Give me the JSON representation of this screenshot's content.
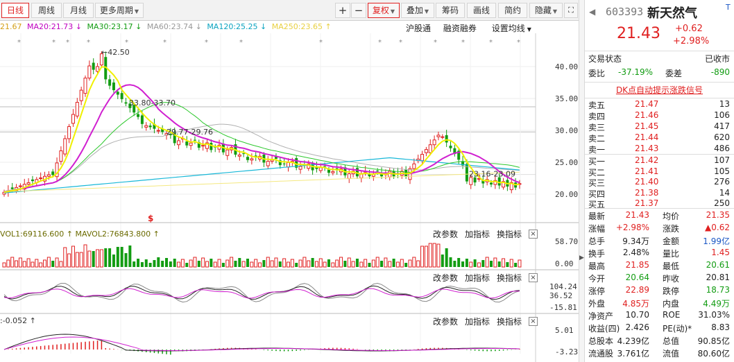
{
  "toolbar": {
    "tabs": [
      {
        "label": "日线",
        "active": true
      },
      {
        "label": "周线"
      },
      {
        "label": "月线"
      },
      {
        "label": "更多周期"
      }
    ],
    "zoom_in": "+",
    "zoom_out": "−",
    "buttons": [
      "复权",
      "叠加",
      "筹码",
      "画线",
      "简约",
      "隐藏"
    ]
  },
  "chart": {
    "ma_legend": [
      {
        "text": "21.67",
        "color": "#d4a017"
      },
      {
        "text": "MA20:21.73 ↓",
        "color": "#c000c0"
      },
      {
        "text": "MA30:23.17 ↓",
        "color": "#129c12"
      },
      {
        "text": "MA60:23.74 ↓",
        "color": "#999999"
      },
      {
        "text": "MA120:25.25 ↓",
        "color": "#0aa3c0"
      },
      {
        "text": "MA250:23.65 ↑",
        "color": "#f0e060"
      }
    ],
    "links": [
      "沪股通",
      "融资融券",
      "设置均线"
    ],
    "price_axis": [
      "40.00",
      "35.00",
      "30.00",
      "25.00",
      "20.00"
    ],
    "annotations": {
      "high": "42.50",
      "box1": "33.80-33.70",
      "box2": "29.77-29.76",
      "box3": "23.16-23.09"
    },
    "dollar": "$",
    "vol_label": "VOL1:69116.600 ↑ MAVOL2:76843.800 ↑",
    "vol_axis": [
      "58.70",
      "0.00"
    ],
    "kdj_axis": [
      "104.24",
      "36.52",
      "-15.81"
    ],
    "macd_label": ":-0.052 ↑",
    "macd_axis": [
      "5.01",
      "-3.23"
    ],
    "panel_links": [
      "改参数",
      "加指标",
      "换指标"
    ],
    "close": "×",
    "colors": {
      "up": "#e02020",
      "down": "#129c12",
      "ma5": "#f0f000",
      "ma10": "#d020d0",
      "ma30": "#2cc82c",
      "ma60": "#b0b0b0",
      "ma120": "#18b8d8"
    }
  },
  "quote": {
    "code": "603393",
    "name": "新天然气",
    "price": "21.43",
    "change": "+0.62",
    "change_pct": "+2.98%",
    "status_label": "交易状态",
    "status_value": "已收市",
    "weibi_label": "委比",
    "weibi_value": "-37.19%",
    "weicha_label": "委差",
    "weicha_value": "-890",
    "signal": "DK点自动提示涨跌信号",
    "asks": [
      {
        "label": "卖五",
        "price": "21.47",
        "vol": "13"
      },
      {
        "label": "卖四",
        "price": "21.46",
        "vol": "106"
      },
      {
        "label": "卖三",
        "price": "21.45",
        "vol": "417"
      },
      {
        "label": "卖二",
        "price": "21.44",
        "vol": "620"
      },
      {
        "label": "卖一",
        "price": "21.43",
        "vol": "486"
      }
    ],
    "bids": [
      {
        "label": "买一",
        "price": "21.42",
        "vol": "107"
      },
      {
        "label": "买二",
        "price": "21.41",
        "vol": "105"
      },
      {
        "label": "买三",
        "price": "21.40",
        "vol": "276"
      },
      {
        "label": "买四",
        "price": "21.38",
        "vol": "14"
      },
      {
        "label": "买五",
        "price": "21.37",
        "vol": "250"
      }
    ],
    "stats": [
      {
        "l1": "最新",
        "v1": "21.43",
        "c1": "red",
        "l2": "均价",
        "v2": "21.35",
        "c2": "red"
      },
      {
        "l1": "涨幅",
        "v1": "+2.98%",
        "c1": "red",
        "l2": "涨跌",
        "v2": "▲0.62",
        "c2": "red"
      },
      {
        "l1": "总手",
        "v1": "9.34万",
        "c1": "",
        "l2": "金额",
        "v2": "1.99亿",
        "c2": "blue"
      },
      {
        "l1": "换手",
        "v1": "2.48%",
        "c1": "",
        "l2": "量比",
        "v2": "1.45",
        "c2": "red"
      },
      {
        "l1": "最高",
        "v1": "21.85",
        "c1": "red",
        "l2": "最低",
        "v2": "20.61",
        "c2": "green"
      },
      {
        "l1": "今开",
        "v1": "20.64",
        "c1": "green",
        "l2": "昨收",
        "v2": "20.81",
        "c2": ""
      },
      {
        "l1": "涨停",
        "v1": "22.89",
        "c1": "red",
        "l2": "跌停",
        "v2": "18.73",
        "c2": "green"
      },
      {
        "l1": "外盘",
        "v1": "4.85万",
        "c1": "red",
        "l2": "内盘",
        "v2": "4.49万",
        "c2": "green"
      },
      {
        "l1": "净资产",
        "v1": "10.70",
        "c1": "",
        "l2": "ROE",
        "v2": "31.03%",
        "c2": ""
      },
      {
        "l1": "收益(四)",
        "v1": "2.426",
        "c1": "",
        "l2": "PE(动)*",
        "v2": "8.83",
        "c2": ""
      },
      {
        "l1": "总股本",
        "v1": "4.239亿",
        "c1": "",
        "l2": "总值",
        "v2": "90.85亿",
        "c2": ""
      },
      {
        "l1": "流通股",
        "v1": "3.761亿",
        "c1": "",
        "l2": "流值",
        "v2": "80.60亿",
        "c2": ""
      }
    ]
  }
}
